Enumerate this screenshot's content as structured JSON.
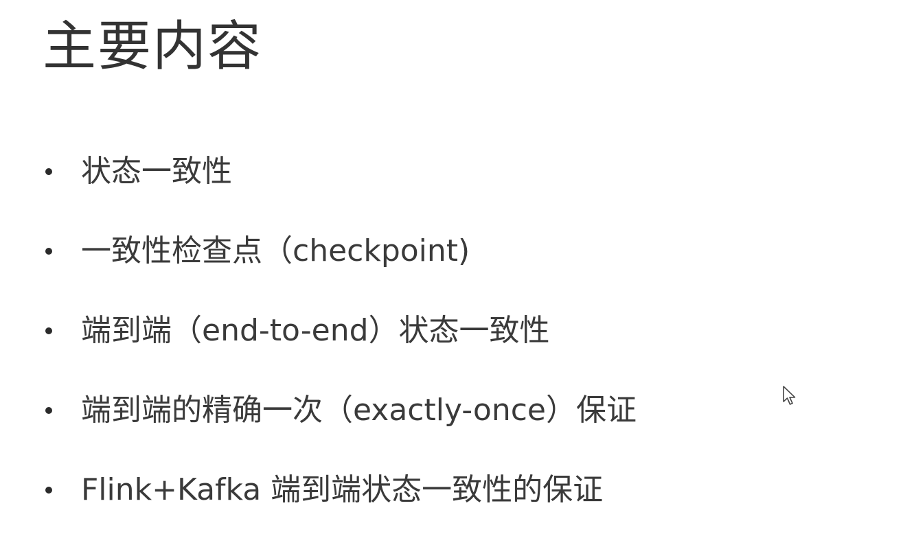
{
  "slide": {
    "title": "主要内容",
    "bullets": [
      {
        "text": "状态一致性"
      },
      {
        "text": "一致性检查点（checkpoint)"
      },
      {
        "text": "端到端（end-to-end）状态一致性"
      },
      {
        "text": "端到端的精确一次（exactly-once）保证"
      },
      {
        "text": "Flink+Kafka 端到端状态一致性的保证"
      }
    ]
  },
  "cursor": {
    "icon": "mouse-pointer-icon"
  }
}
